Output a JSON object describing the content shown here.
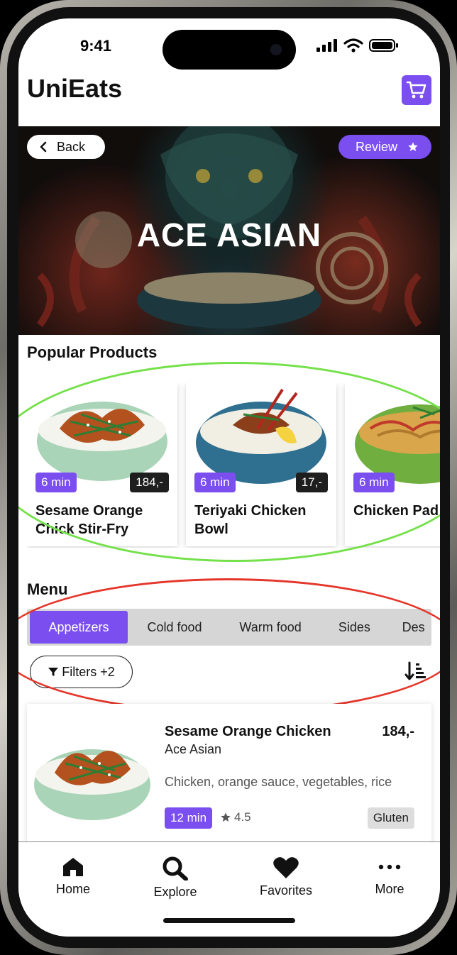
{
  "status": {
    "time": "9:41"
  },
  "header": {
    "app_title": "UniEats",
    "cart_icon": "cart-icon"
  },
  "hero": {
    "title": "ACE ASIAN",
    "back_label": "Back",
    "review_label": "Review"
  },
  "popular": {
    "title": "Popular Products",
    "items": [
      {
        "name": "Sesame Orange Chick Stir-Fry",
        "time": "6 min",
        "price": "184,-"
      },
      {
        "name": "Teriyaki Chicken Bowl",
        "time": "6 min",
        "price": "17,-"
      },
      {
        "name": "Chicken Pad",
        "time": "6 min",
        "price": ""
      }
    ]
  },
  "menu": {
    "title": "Menu",
    "tabs": [
      "Appetizers",
      "Cold food",
      "Warm food",
      "Sides",
      "Des"
    ],
    "active_tab": "Appetizers",
    "filters_label": "Filters +2",
    "items": [
      {
        "name": "Sesame Orange Chicken",
        "price": "184,-",
        "restaurant": "Ace Asian",
        "description": "Chicken, orange sauce, vegetables, rice",
        "time": "12 min",
        "rating": "4.5",
        "tag": "Gluten"
      }
    ]
  },
  "nav": [
    {
      "label": "Home",
      "icon": "home-icon"
    },
    {
      "label": "Explore",
      "icon": "search-icon"
    },
    {
      "label": "Favorites",
      "icon": "heart-icon"
    },
    {
      "label": "More",
      "icon": "more-dots-icon"
    }
  ],
  "colors": {
    "accent": "#7b4ef0",
    "annotation_green": "#74e04a",
    "annotation_red": "#e4362a"
  }
}
